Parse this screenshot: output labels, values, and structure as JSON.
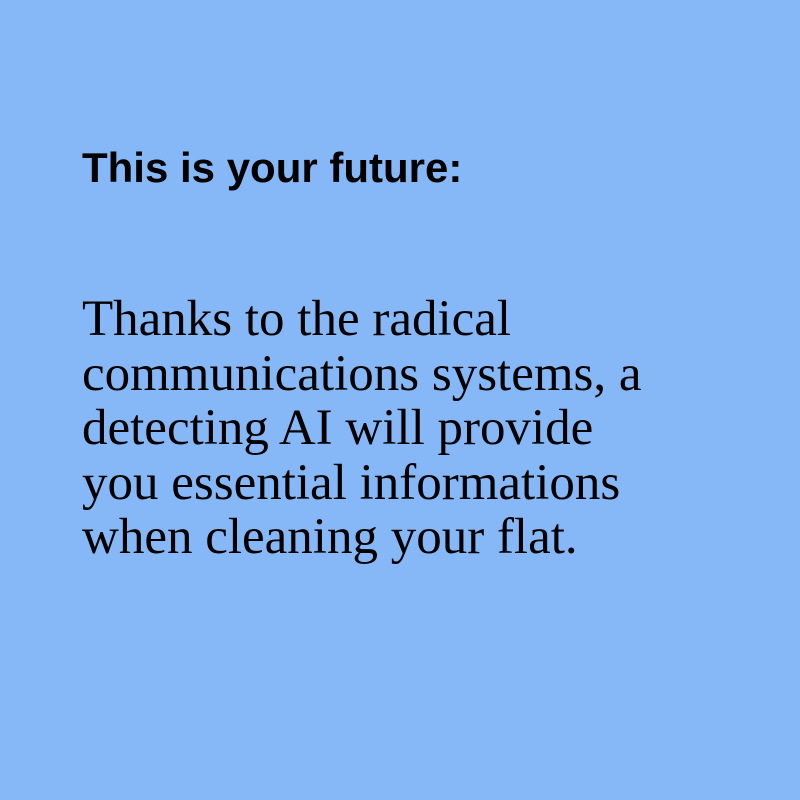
{
  "background_color": "#86b8f8",
  "title": "This is your future:",
  "body_lines": [
    "Thanks to the radical",
    "communications systems, a",
    "detecting AI will provide",
    "you essential informations",
    "when cleaning your flat."
  ]
}
